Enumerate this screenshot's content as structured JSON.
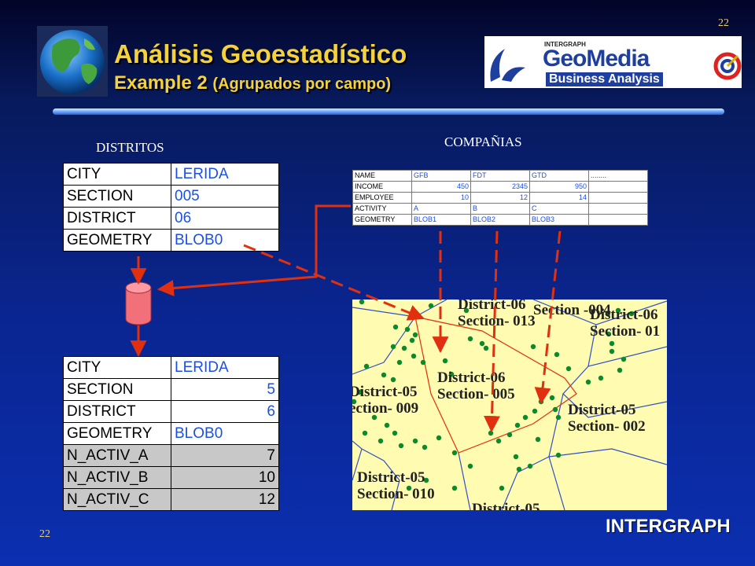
{
  "slide": {
    "page_number_top": "22",
    "page_number_bottom": "22",
    "title": "Análisis  Geoestadístico",
    "subtitle_main": "Example 2",
    "subtitle_paren": "(Agrupados por campo)",
    "logo_geomedia_small": "INTERGRAPH",
    "logo_geomedia_main": "GeoMedia",
    "logo_geomedia_sub": "Business Analysis",
    "logo_intergraph": "INTERGRAPH"
  },
  "distritos": {
    "label": "DISTRITOS",
    "rows": [
      {
        "k": "CITY",
        "v": "LERIDA"
      },
      {
        "k": "SECTION",
        "v": "005"
      },
      {
        "k": "DISTRICT",
        "v": "06"
      },
      {
        "k": "GEOMETRY",
        "v": "BLOB0"
      }
    ]
  },
  "companias": {
    "label": "COMPAÑIAS",
    "rows": [
      {
        "k": "NAME",
        "a": "GFB",
        "b": "FDT",
        "c": "GTD",
        "d": "........"
      },
      {
        "k": "INCOME",
        "a": "450",
        "b": "2345",
        "c": "950",
        "d": ""
      },
      {
        "k": "EMPLOYEE",
        "a": "10",
        "b": "12",
        "c": "14",
        "d": ""
      },
      {
        "k": "ACTIVITY",
        "a": "A",
        "b": "B",
        "c": "C",
        "d": ""
      },
      {
        "k": "GEOMETRY",
        "a": "BLOB1",
        "b": "BLOB2",
        "c": "BLOB3",
        "d": ""
      }
    ]
  },
  "result": {
    "rows": [
      {
        "k": "CITY",
        "v": "LERIDA"
      },
      {
        "k": "SECTION",
        "v": "5"
      },
      {
        "k": "DISTRICT",
        "v": "6"
      },
      {
        "k": "GEOMETRY",
        "v": "BLOB0"
      },
      {
        "k": "N_ACTIV_A",
        "v": "7"
      },
      {
        "k": "N_ACTIV_B",
        "v": "10"
      },
      {
        "k": "N_ACTIV_C",
        "v": "12"
      }
    ]
  },
  "map": {
    "labels": [
      {
        "l1": "District-06",
        "l2": "Section- 013"
      },
      {
        "l1": "Section -004",
        "l2": ""
      },
      {
        "l1": "District-06",
        "l2": "Section- 01"
      },
      {
        "l1": "District-06",
        "l2": "Section- 005"
      },
      {
        "l1": "District-05",
        "l2": "ection- 009"
      },
      {
        "l1": "District-05",
        "l2": "Section- 002"
      },
      {
        "l1": "District-05",
        "l2": "Section- 010"
      },
      {
        "l1": "District-05",
        "l2": ""
      }
    ]
  },
  "colors": {
    "title": "#f5d23a",
    "arrow": "#e03010",
    "map_bg": "#fffbb0",
    "point": "#0a8a2a",
    "boundary": "#3050c8",
    "highlight_boundary": "#e03010"
  }
}
